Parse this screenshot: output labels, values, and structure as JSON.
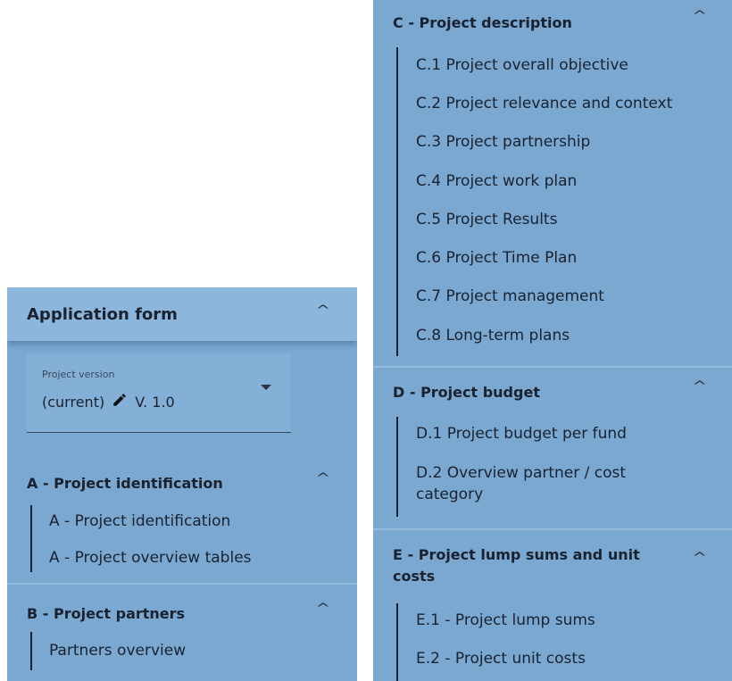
{
  "left_panel": {
    "title": "Application form",
    "version": {
      "label": "Project version",
      "current_text": "(current)",
      "version_text": "V. 1.0"
    },
    "sections": [
      {
        "title": "A - Project identification",
        "items": [
          "A - Project identification",
          "A - Project overview tables"
        ]
      },
      {
        "title": "B - Project partners",
        "items": [
          "Partners overview"
        ]
      }
    ]
  },
  "right_panel": {
    "sections": [
      {
        "title": "C - Project description",
        "items": [
          "C.1 Project overall objective",
          "C.2 Project relevance and context",
          "C.3 Project partnership",
          "C.4 Project work plan",
          "C.5 Project Results",
          "C.6 Project Time Plan",
          "C.7 Project management",
          "C.8 Long-term plans"
        ]
      },
      {
        "title": "D - Project budget",
        "items": [
          "D.1 Project budget per fund",
          "D.2 Overview partner / cost category"
        ]
      },
      {
        "title": "E - Project lump sums and unit costs",
        "items": [
          "E.1 - Project lump sums",
          "E.2 - Project unit costs"
        ]
      }
    ]
  },
  "icons": {
    "expand": "chevron-up-icon",
    "edit": "pencil-icon",
    "dropdown": "caret-down-icon"
  },
  "colors": {
    "panel_bg": "#7aa8d1",
    "header_bg": "#8cb6dc",
    "text": "#1a2230"
  }
}
